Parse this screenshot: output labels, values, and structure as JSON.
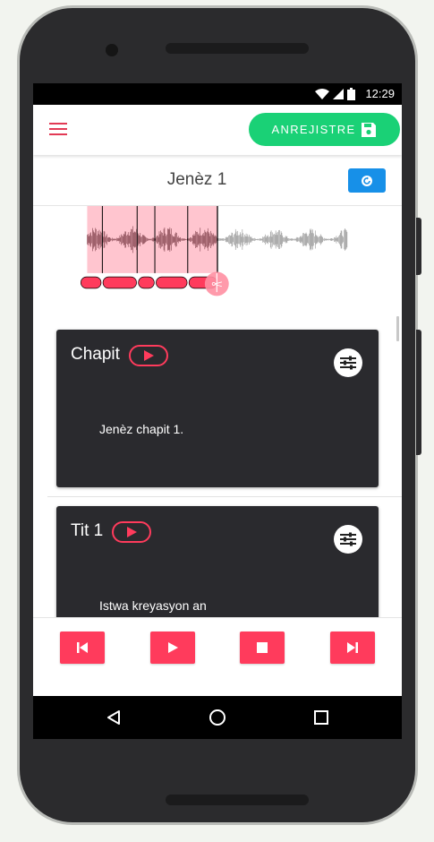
{
  "status_bar": {
    "time": "12:29"
  },
  "app_bar": {
    "record_label": "ANREJISTRE"
  },
  "book": {
    "title": "Jenèz 1"
  },
  "cards": [
    {
      "title": "Chapit",
      "text": "Jenèz chapit 1."
    },
    {
      "title": "Tit 1",
      "text": "Istwa kreyasyon an"
    }
  ],
  "colors": {
    "accent": "#ff3b5c",
    "record_green": "#1ad176",
    "refresh_blue": "#1790e8",
    "card_bg": "#2a2a2e",
    "waveform_highlight": "#ffc5cf"
  },
  "icons": {
    "menu": "menu-icon",
    "save": "save-icon",
    "refresh": "refresh-icon",
    "split": "scissors-icon",
    "play": "play-icon",
    "settings": "sliders-icon",
    "previous": "skip-previous-icon",
    "stop": "stop-icon",
    "next": "skip-next-icon",
    "back": "back-icon",
    "home": "home-icon",
    "recents": "recents-icon"
  }
}
